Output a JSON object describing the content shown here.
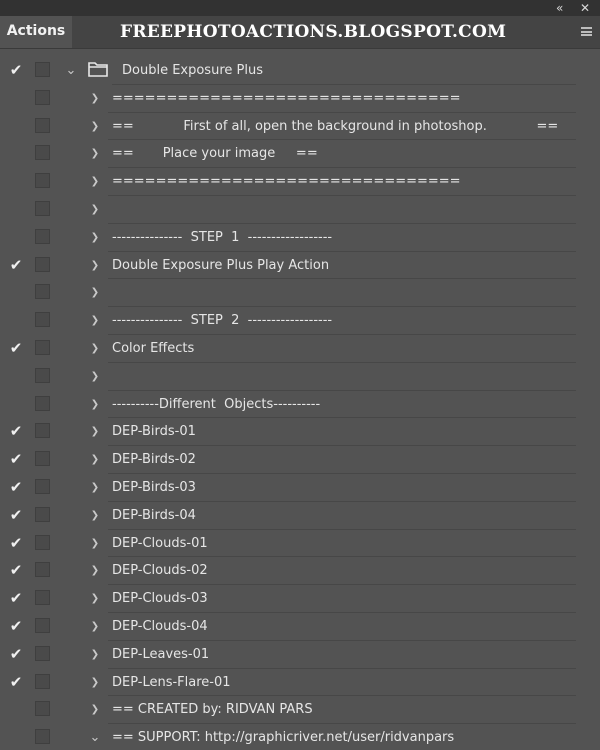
{
  "window": {
    "collapse_icon": "double-chevron-left-icon",
    "close_icon": "close-icon",
    "collapse_glyph": "«",
    "close_glyph": "✕"
  },
  "panel": {
    "tab_label": "Actions",
    "watermark": "FREEPHOTOACTIONS.BLOGSPOT.COM",
    "menu_icon": "panel-menu-icon"
  },
  "set": {
    "name": "Double Exposure Plus",
    "checked": true,
    "expanded": true
  },
  "actions": [
    {
      "label": "================================",
      "checked": false
    },
    {
      "label": "==            First of all, open the background in photoshop.            ==",
      "checked": false
    },
    {
      "label": "==       Place your image     ==",
      "checked": false
    },
    {
      "label": "================================",
      "checked": false
    },
    {
      "label": "",
      "checked": false
    },
    {
      "label": "---------------  STEP  1  ------------------",
      "checked": false
    },
    {
      "label": "Double Exposure Plus Play Action",
      "checked": true
    },
    {
      "label": "",
      "checked": false
    },
    {
      "label": "---------------  STEP  2  ------------------",
      "checked": false
    },
    {
      "label": "Color Effects",
      "checked": true
    },
    {
      "label": "",
      "checked": false
    },
    {
      "label": "----------Different  Objects----------",
      "checked": false
    },
    {
      "label": "DEP-Birds-01",
      "checked": true
    },
    {
      "label": "DEP-Birds-02",
      "checked": true
    },
    {
      "label": "DEP-Birds-03",
      "checked": true
    },
    {
      "label": "DEP-Birds-04",
      "checked": true
    },
    {
      "label": "DEP-Clouds-01",
      "checked": true
    },
    {
      "label": "DEP-Clouds-02",
      "checked": true
    },
    {
      "label": "DEP-Clouds-03",
      "checked": true
    },
    {
      "label": "DEP-Clouds-04",
      "checked": true
    },
    {
      "label": "DEP-Leaves-01",
      "checked": true
    },
    {
      "label": "DEP-Lens-Flare-01",
      "checked": true
    },
    {
      "label": "== CREATED by: RIDVAN PARS",
      "checked": false
    },
    {
      "label": "== SUPPORT: http://graphicriver.net/user/ridvanpars",
      "checked": false,
      "expanded": true
    }
  ],
  "glyphs": {
    "check": "✔",
    "collapsed": "❯",
    "expanded": "⌄"
  },
  "colors": {
    "panel_bg": "#535353",
    "tab_strip_bg": "#444444",
    "title_bar_bg": "#323232",
    "text": "#e6e6e6"
  }
}
